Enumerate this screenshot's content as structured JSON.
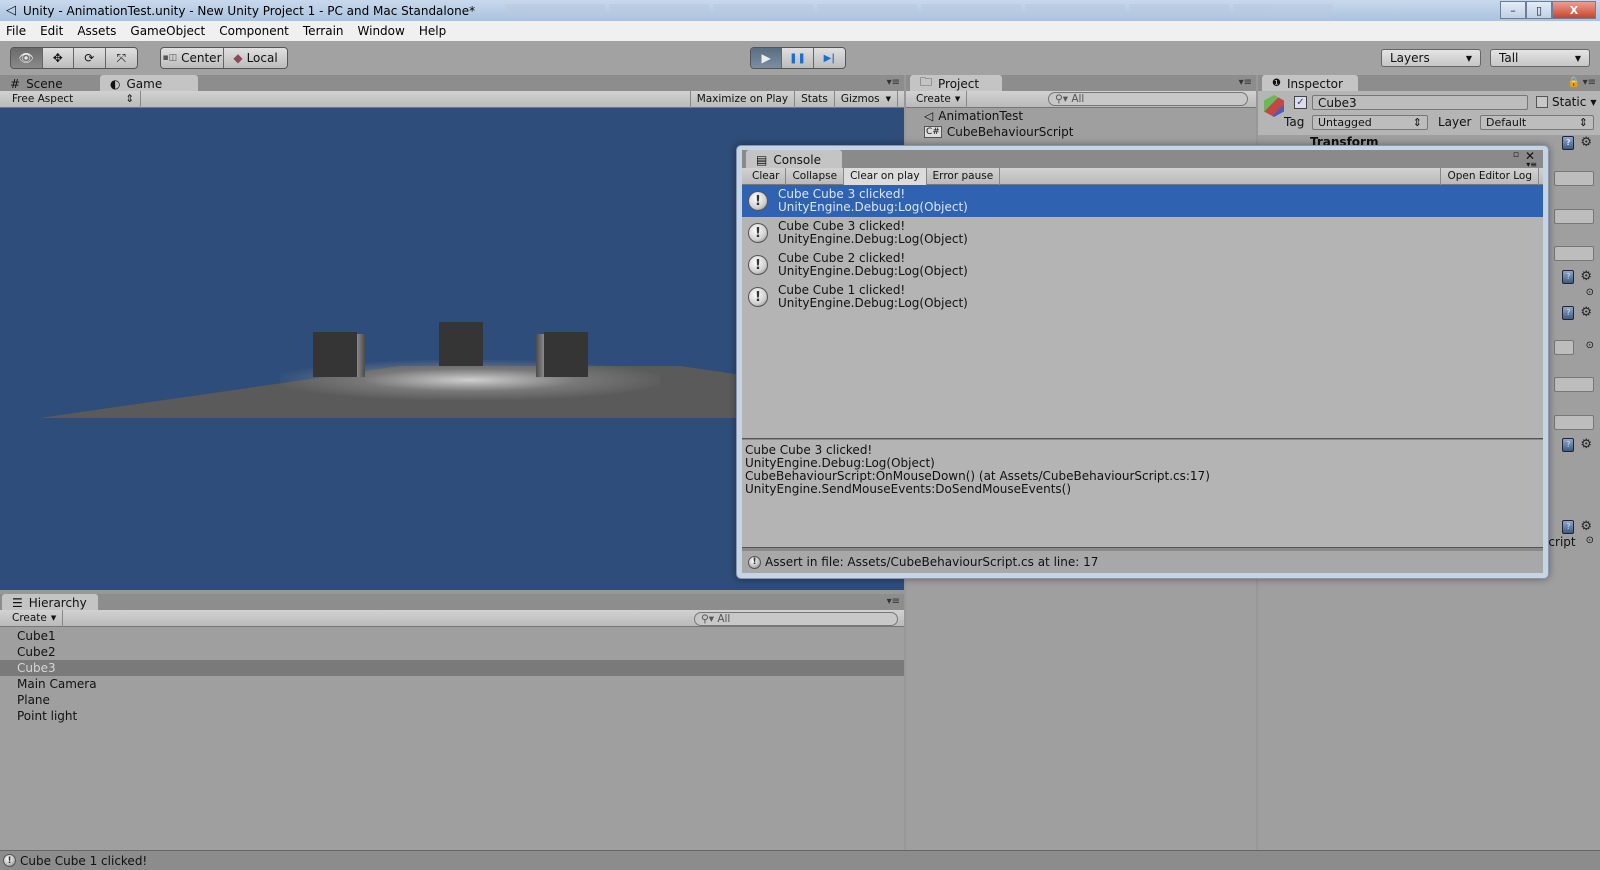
{
  "window": {
    "title": "Unity - AnimationTest.unity - New Unity Project 1 - PC and Mac Standalone*",
    "controls": {
      "minimize": "–",
      "maximize": "▯",
      "close": "X"
    }
  },
  "menu": [
    "File",
    "Edit",
    "Assets",
    "GameObject",
    "Component",
    "Terrain",
    "Window",
    "Help"
  ],
  "toolbar": {
    "tools": [
      {
        "name": "view-tool",
        "glyph": "👁",
        "active": true
      },
      {
        "name": "move-tool",
        "glyph": "✥",
        "active": false
      },
      {
        "name": "rotate-tool",
        "glyph": "⟳",
        "active": false
      },
      {
        "name": "scale-tool",
        "glyph": "⤧",
        "active": false
      }
    ],
    "pivot": {
      "center_label": "Center",
      "local_label": "Local"
    },
    "play": {
      "play": "▶",
      "pause": "❚❚",
      "step": "▶|"
    },
    "layers_label": "Layers",
    "layout_label": "Tall"
  },
  "game_panel": {
    "tabs": [
      {
        "label": "Scene",
        "icon": "#"
      },
      {
        "label": "Game",
        "icon": "◐"
      }
    ],
    "aspect": "Free Aspect",
    "buttons": [
      "Maximize on Play",
      "Stats",
      "Gizmos"
    ],
    "background_color": "#2e4d7a"
  },
  "project_panel": {
    "tab": "Project",
    "create_label": "Create",
    "search_placeholder": "All",
    "items": [
      {
        "label": "AnimationTest",
        "icon": "unity-scene-icon"
      },
      {
        "label": "CubeBehaviourScript",
        "icon": "csharp-script-icon"
      }
    ]
  },
  "inspector": {
    "tab": "Inspector",
    "object_name": "Cube3",
    "active": true,
    "static_label": "Static",
    "tag_label": "Tag",
    "tag_value": "Untagged",
    "layer_label": "Layer",
    "layer_value": "Default",
    "component_header": "Transform",
    "partial_script_label": "Script"
  },
  "console": {
    "tab": "Console",
    "buttons": [
      "Clear",
      "Collapse",
      "Clear on play",
      "Error pause"
    ],
    "open_log": "Open Editor Log",
    "entries": [
      {
        "message": "Cube Cube 3 clicked!",
        "trace": "UnityEngine.Debug:Log(Object)",
        "selected": true
      },
      {
        "message": "Cube Cube 3 clicked!",
        "trace": "UnityEngine.Debug:Log(Object)",
        "selected": false
      },
      {
        "message": "Cube Cube 2 clicked!",
        "trace": "UnityEngine.Debug:Log(Object)",
        "selected": false
      },
      {
        "message": "Cube Cube 1 clicked!",
        "trace": "UnityEngine.Debug:Log(Object)",
        "selected": false
      }
    ],
    "detail": [
      "Cube Cube 3 clicked!",
      "UnityEngine.Debug:Log(Object)",
      "CubeBehaviourScript:OnMouseDown() (at Assets/CubeBehaviourScript.cs:17)",
      "UnityEngine.SendMouseEvents:DoSendMouseEvents()"
    ],
    "status": "Assert in file: Assets/CubeBehaviourScript.cs at line: 17",
    "selection_color": "#2f62b0"
  },
  "hierarchy": {
    "tab": "Hierarchy",
    "create_label": "Create",
    "search_placeholder": "All",
    "items": [
      "Cube1",
      "Cube2",
      "Cube3",
      "Main Camera",
      "Plane",
      "Point light"
    ],
    "selected": "Cube3"
  },
  "statusbar": {
    "message": "Cube Cube 1 clicked!"
  }
}
